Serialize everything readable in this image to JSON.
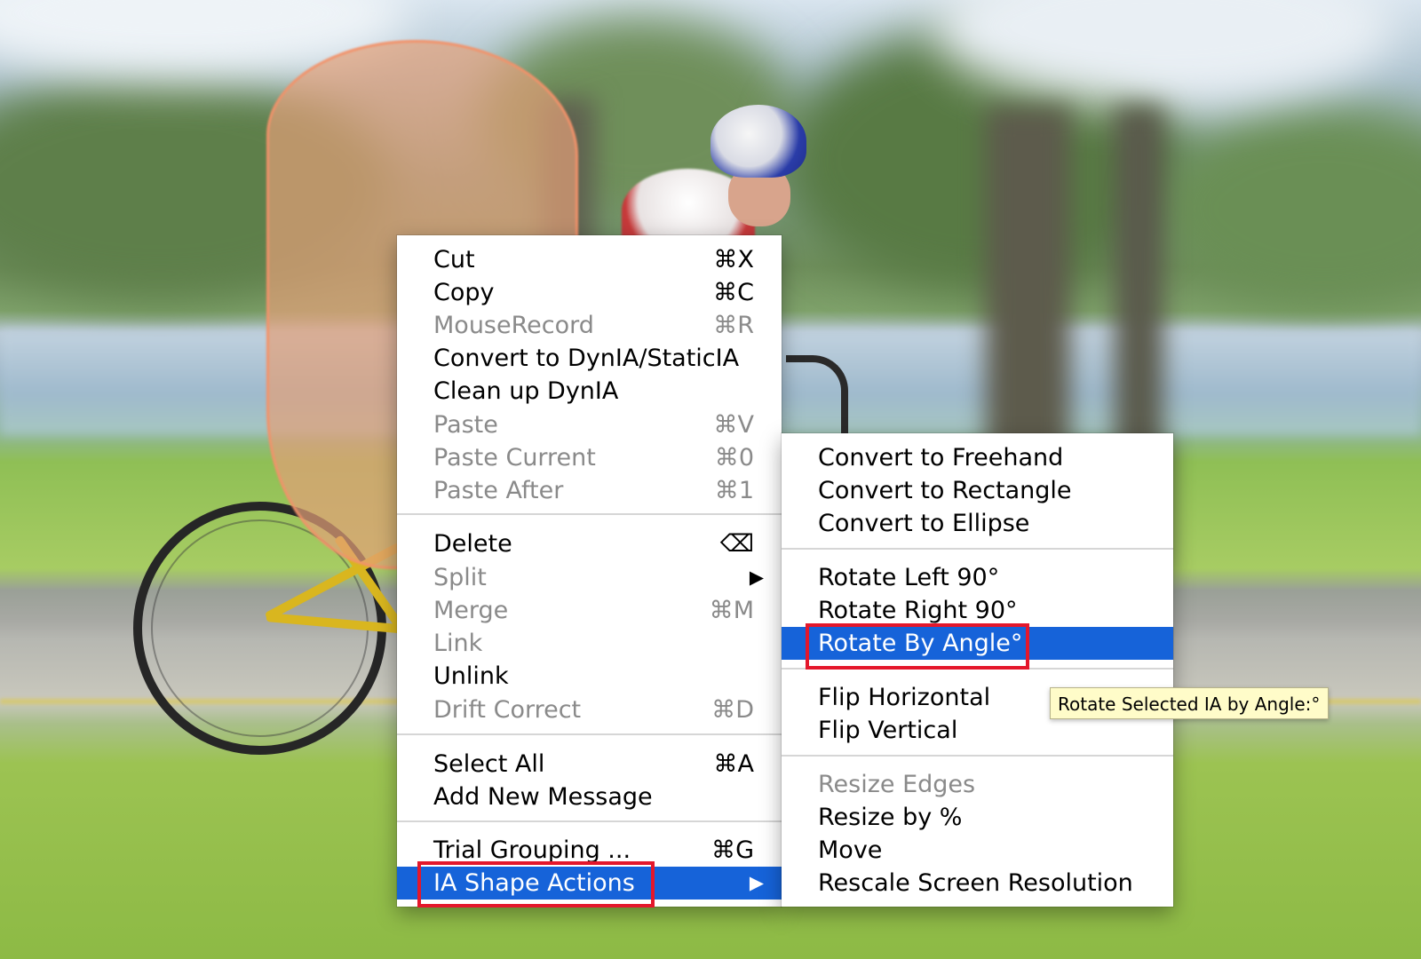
{
  "main_menu": {
    "items": [
      {
        "label": "Cut",
        "shortcut": "⌘X",
        "state": "enabled"
      },
      {
        "label": "Copy",
        "shortcut": "⌘C",
        "state": "enabled"
      },
      {
        "label": "MouseRecord",
        "shortcut": "⌘R",
        "state": "disabled"
      },
      {
        "label": "Convert to DynIA/StaticIA",
        "shortcut": "",
        "state": "enabled"
      },
      {
        "label": "Clean up DynIA",
        "shortcut": "",
        "state": "enabled"
      },
      {
        "label": "Paste",
        "shortcut": "⌘V",
        "state": "disabled"
      },
      {
        "label": "Paste Current",
        "shortcut": "⌘0",
        "state": "disabled"
      },
      {
        "label": "Paste After",
        "shortcut": "⌘1",
        "state": "disabled"
      },
      {
        "label": "Delete",
        "shortcut": "⌫",
        "state": "enabled"
      },
      {
        "label": "Split",
        "shortcut": "▶",
        "state": "disabled"
      },
      {
        "label": "Merge",
        "shortcut": "⌘M",
        "state": "disabled"
      },
      {
        "label": "Link",
        "shortcut": "",
        "state": "disabled"
      },
      {
        "label": "Unlink",
        "shortcut": "",
        "state": "enabled"
      },
      {
        "label": "Drift Correct",
        "shortcut": "⌘D",
        "state": "disabled"
      },
      {
        "label": "Select All",
        "shortcut": "⌘A",
        "state": "enabled"
      },
      {
        "label": "Add New Message",
        "shortcut": "",
        "state": "enabled"
      },
      {
        "label": "Trial Grouping ...",
        "shortcut": "⌘G",
        "state": "enabled"
      },
      {
        "label": "IA Shape Actions",
        "shortcut": "▶",
        "state": "highlighted"
      }
    ]
  },
  "sub_menu": {
    "items": [
      {
        "label": "Convert to Freehand",
        "state": "enabled"
      },
      {
        "label": "Convert to Rectangle",
        "state": "enabled"
      },
      {
        "label": "Convert to Ellipse",
        "state": "enabled"
      },
      {
        "label": "Rotate Left 90°",
        "state": "enabled"
      },
      {
        "label": "Rotate Right 90°",
        "state": "enabled"
      },
      {
        "label": "Rotate By Angle°",
        "state": "highlighted"
      },
      {
        "label": "Flip Horizontal",
        "state": "enabled"
      },
      {
        "label": "Flip Vertical",
        "state": "enabled"
      },
      {
        "label": "Resize Edges",
        "state": "disabled"
      },
      {
        "label": "Resize by %",
        "state": "enabled"
      },
      {
        "label": "Move",
        "state": "enabled"
      },
      {
        "label": "Rescale Screen Resolution",
        "state": "enabled"
      }
    ]
  },
  "tooltip": {
    "text": "Rotate Selected IA by Angle:°"
  },
  "colors": {
    "highlight": "#1663d9",
    "annotation_box": "#e4172b",
    "ia_outline": "#f2926a",
    "tooltip_bg": "#fffcc9"
  }
}
